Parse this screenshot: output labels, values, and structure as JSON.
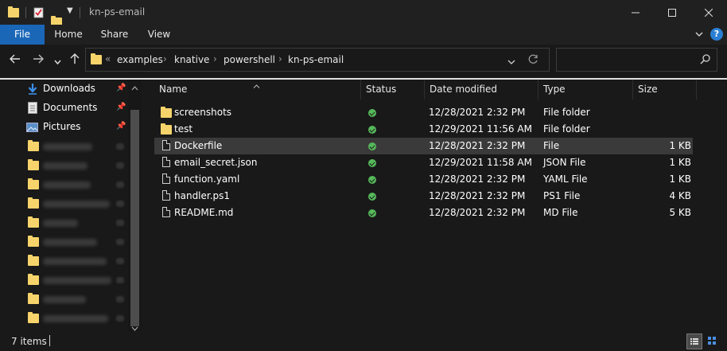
{
  "window": {
    "title": "kn-ps-email"
  },
  "ribbon": {
    "tabs": [
      "File",
      "Home",
      "Share",
      "View"
    ],
    "help": "?"
  },
  "address": {
    "overflow": "«",
    "crumbs": [
      "examples",
      "knative",
      "powershell",
      "kn-ps-email"
    ],
    "search_placeholder": ""
  },
  "nav_pane": {
    "items": [
      {
        "label": "Downloads",
        "icon": "download-arrow-icon"
      },
      {
        "label": "Documents",
        "icon": "documents-icon"
      },
      {
        "label": "Pictures",
        "icon": "pictures-icon"
      }
    ]
  },
  "columns": [
    "Name",
    "Status",
    "Date modified",
    "Type",
    "Size"
  ],
  "files": [
    {
      "name": "screenshots",
      "date": "12/28/2021 2:32 PM",
      "type": "File folder",
      "size": "",
      "kind": "folder"
    },
    {
      "name": "test",
      "date": "12/29/2021 11:56 AM",
      "type": "File folder",
      "size": "",
      "kind": "folder"
    },
    {
      "name": "Dockerfile",
      "date": "12/28/2021 2:32 PM",
      "type": "File",
      "size": "1 KB",
      "kind": "file"
    },
    {
      "name": "email_secret.json",
      "date": "12/29/2021 11:58 AM",
      "type": "JSON File",
      "size": "1 KB",
      "kind": "file"
    },
    {
      "name": "function.yaml",
      "date": "12/28/2021 2:32 PM",
      "type": "YAML File",
      "size": "1 KB",
      "kind": "file"
    },
    {
      "name": "handler.ps1",
      "date": "12/28/2021 2:32 PM",
      "type": "PS1 File",
      "size": "4 KB",
      "kind": "file"
    },
    {
      "name": "README.md",
      "date": "12/28/2021 2:32 PM",
      "type": "MD File",
      "size": "5 KB",
      "kind": "file"
    }
  ],
  "status_bar": {
    "item_count": "7 items"
  },
  "colors": {
    "accent": "#1a67b8",
    "folder": "#f7d46b",
    "status_ok": "#56b85a",
    "selected_row": "#3a3a3a"
  }
}
